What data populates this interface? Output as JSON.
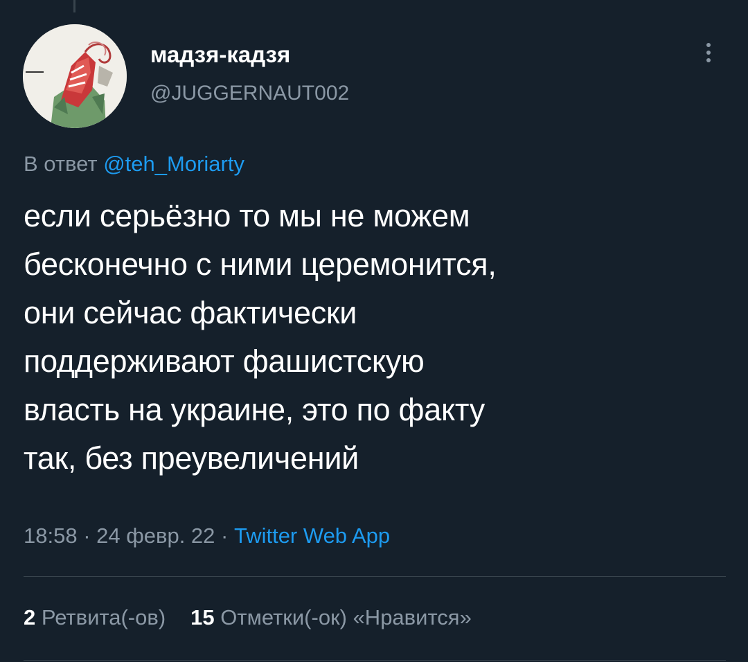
{
  "author": {
    "display_name": "мадзя-кадзя",
    "handle": "@JUGGERNAUT002",
    "avatar_icon": "avatar-illustration-icon"
  },
  "reply": {
    "prefix": "В ответ",
    "mention": "@teh_Moriarty"
  },
  "tweet": {
    "text": "если серьёзно то мы не можем\nбесконечно с ними церемонится,\nони сейчас фактически\nподдерживают фашистскую\nвласть на украине, это по факту\nтак, без преувеличений",
    "time": "18:58",
    "separator_1": " · ",
    "date": "24 февр. 22",
    "separator_2": " · ",
    "source": "Twitter Web App"
  },
  "stats": {
    "retweets_count": "2",
    "retweets_label": "Ретвита(-ов)",
    "likes_count": "15",
    "likes_label": "Отметки(-ок) «Нравится»"
  },
  "colors": {
    "background": "#15202b",
    "primary_text": "#ffffff",
    "secondary_text": "#8b98a5",
    "accent": "#1d9bf0",
    "divider": "#38444d"
  },
  "icons": {
    "more": "more-vertical-icon"
  }
}
